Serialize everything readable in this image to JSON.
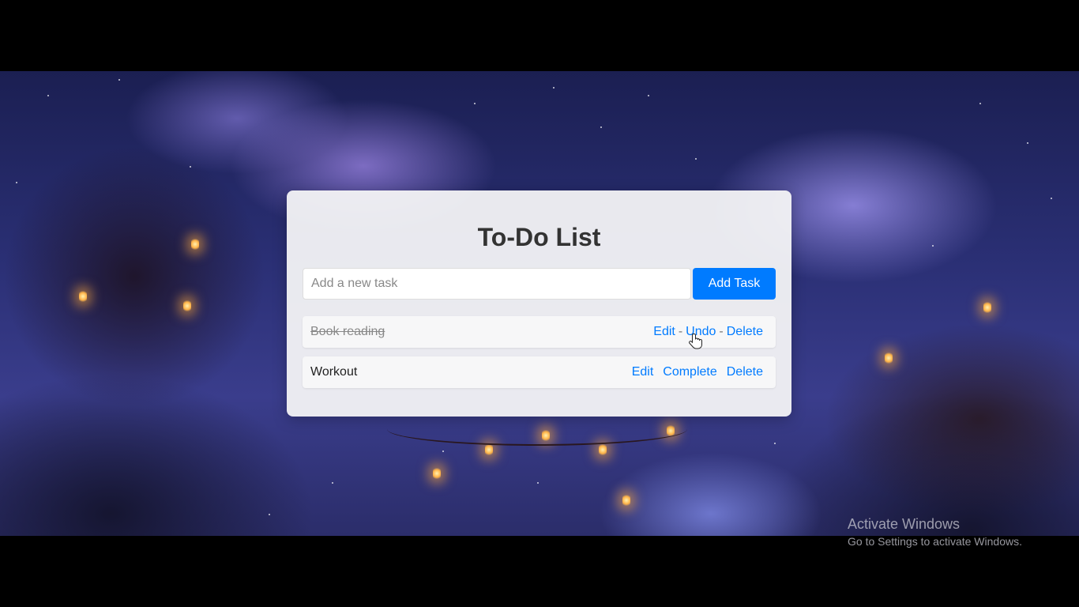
{
  "app": {
    "title": "To-Do List"
  },
  "input": {
    "placeholder": "Add a new task",
    "value": ""
  },
  "add_button": {
    "label": "Add Task"
  },
  "tasks": [
    {
      "text": "Book reading",
      "completed": true,
      "actions": [
        "Edit",
        "Undo",
        "Delete"
      ],
      "separator": "-"
    },
    {
      "text": "Workout",
      "completed": false,
      "actions": [
        "Edit",
        "Complete",
        "Delete"
      ]
    }
  ],
  "os_watermark": {
    "title": "Activate Windows",
    "subtitle": "Go to Settings to activate Windows."
  },
  "colors": {
    "accent": "#007bff",
    "card_bg": "#f5f5f7",
    "title_text": "#333333"
  },
  "icons": {
    "cursor": "hand-pointer-icon"
  }
}
